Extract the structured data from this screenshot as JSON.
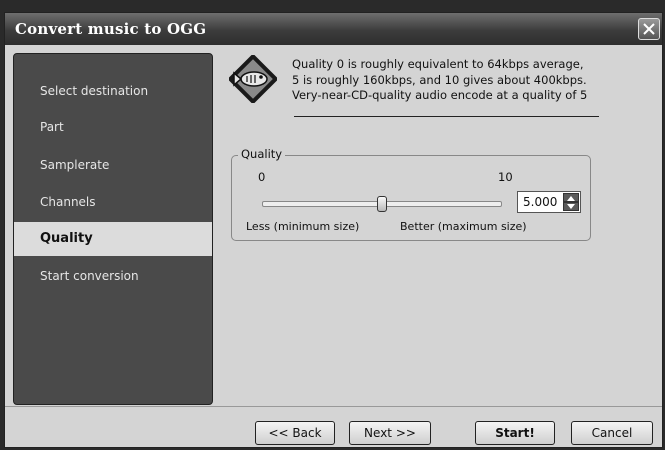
{
  "window": {
    "title": "Convert music to OGG"
  },
  "sidebar": {
    "items": [
      {
        "label": "Select destination"
      },
      {
        "label": "Part"
      },
      {
        "label": "Samplerate"
      },
      {
        "label": "Channels"
      },
      {
        "label": "Quality",
        "active": true
      },
      {
        "label": "Start conversion"
      }
    ]
  },
  "description": {
    "icon": "ogg-fish-logo",
    "lines": [
      "Quality 0 is roughly equivalent to 64kbps average,",
      "5 is roughly 160kbps, and 10 gives about 400kbps.",
      "Very-near-CD-quality audio encode at a quality of 5"
    ]
  },
  "quality": {
    "group_label": "Quality",
    "min_label": "0",
    "max_label": "10",
    "slider_value": 5,
    "slider_min": 0,
    "slider_max": 10,
    "less_label": "Less (minimum size)",
    "better_label": "Better (maximum size)",
    "spin_value": "5.000"
  },
  "buttons": {
    "back": "<< Back",
    "next": "Next >>",
    "start": "Start!",
    "cancel": "Cancel"
  },
  "colors": {
    "sidebar_bg": "#4a4a4a",
    "active_item_bg": "#dcdcdc",
    "dialog_bg": "#d4d4d4"
  }
}
